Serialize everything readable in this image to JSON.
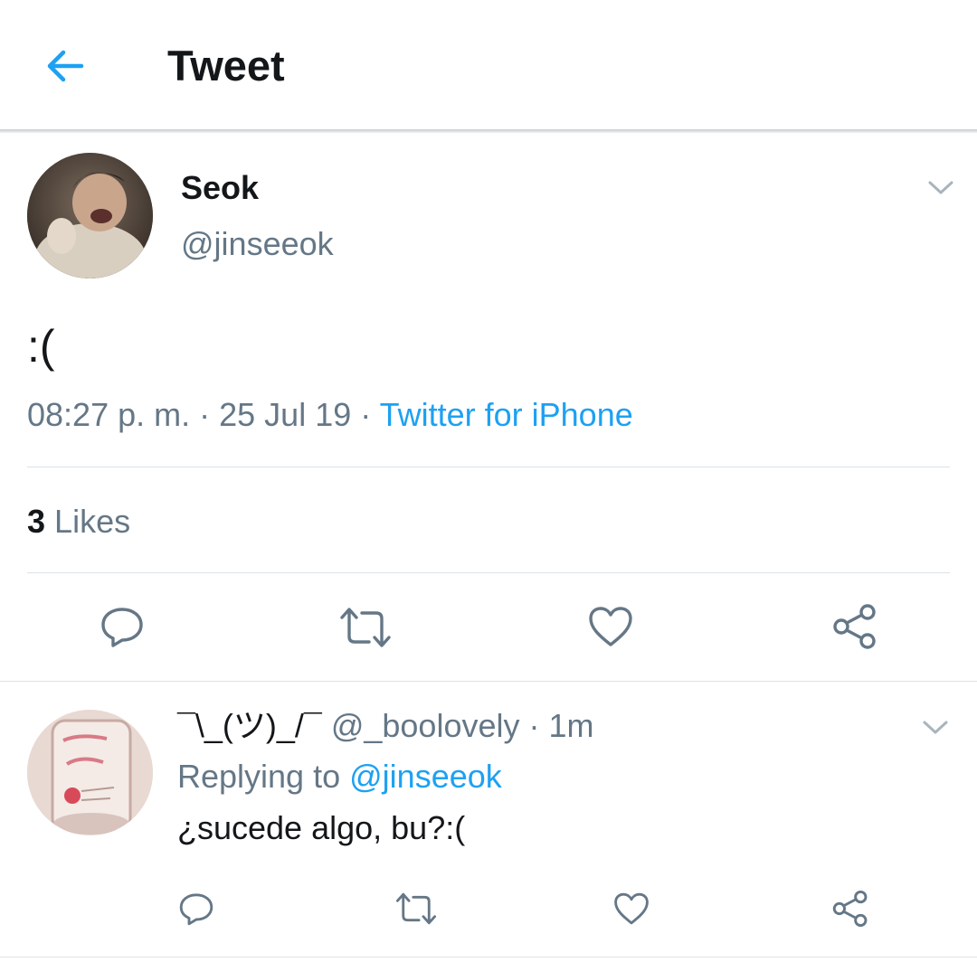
{
  "header": {
    "title": "Tweet",
    "back_icon": "arrow-left-icon",
    "accent_color": "#1da1f2"
  },
  "tweet": {
    "display_name": "Seok",
    "handle": "@jinseeok",
    "text": ":(",
    "time": "08:27 p. m.",
    "separator": "·",
    "date": "25 Jul 19",
    "source": "Twitter for iPhone",
    "likes_count": "3",
    "likes_label": "Likes",
    "caret_icon": "chevron-down-icon",
    "actions": [
      "reply-icon",
      "retweet-icon",
      "like-icon",
      "share-icon"
    ]
  },
  "reply": {
    "display_name": "¯\\_(ツ)_/¯",
    "handle": "@_boolovely",
    "separator": "·",
    "time": "1m",
    "replying_prefix": "Replying to",
    "replying_to": "@jinseeok",
    "text": "¿sucede algo, bu?:(",
    "caret_icon": "chevron-down-icon",
    "actions": [
      "reply-icon",
      "retweet-icon",
      "like-icon",
      "share-icon"
    ]
  },
  "colors": {
    "text_primary": "#14171a",
    "text_secondary": "#657786",
    "link": "#1da1f2",
    "divider": "#dde2e6"
  }
}
